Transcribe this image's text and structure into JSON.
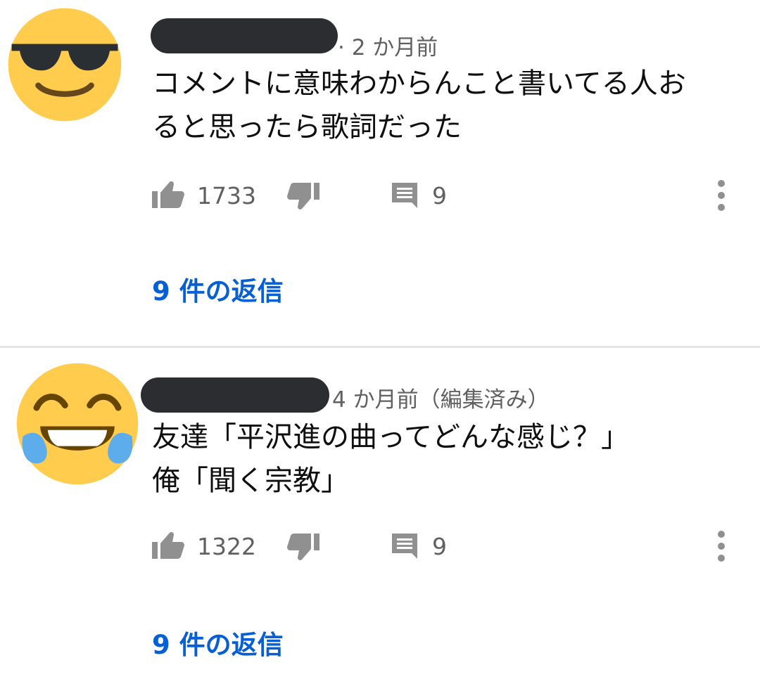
{
  "comments": [
    {
      "avatar_icon": "sunglasses-face-emoji-icon",
      "time": "2 か月前",
      "text_lines": [
        "コメントに意味わからんこと書いてる人お",
        "ると思ったら歌詞だった"
      ],
      "likes": "1733",
      "reply_count": "9",
      "replies_label": "9 件の返信"
    },
    {
      "avatar_icon": "tears-of-joy-emoji-icon",
      "time": "4 か月前（編集済み）",
      "text_lines": [
        "友達「平沢進の曲ってどんな感じ？」",
        "俺「聞く宗教」"
      ],
      "likes": "1322",
      "reply_count": "9",
      "replies_label": "9 件の返信"
    }
  ],
  "icons": {
    "like": "thumbs-up-icon",
    "dislike": "thumbs-down-icon",
    "reply": "comment-icon",
    "more": "more-vertical-icon"
  },
  "colors": {
    "accent": "#065fd4",
    "secondary_text": "#606060",
    "icon": "#909090"
  }
}
